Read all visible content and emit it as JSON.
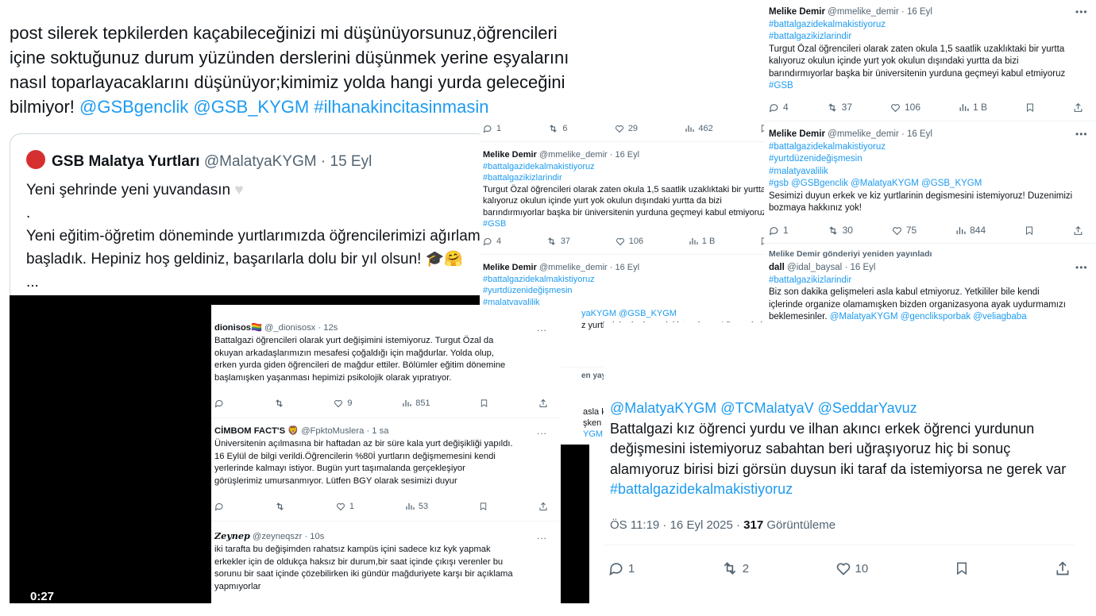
{
  "big_post": {
    "lines": [
      "post silerek tepkilerden kaçabileceğinizi mi düşünüyorsunuz,öğrencileri",
      "içine soktuğunuz durum yüzünden derslerini düşünmek yerine eşyalarını",
      "nasıl toparlayacaklarını düşünüyor;kimimiz yolda hangi yurda geleceğini"
    ],
    "last_line_text": "bilmiyor! ",
    "last_line_tags": "@GSBgenclik @GSB_KYGM #ilhanakincitasinmasin",
    "quote": {
      "name": "GSB Malatya Yurtları",
      "handle": "@MalatyaKYGM",
      "date": "· 15 Eyl",
      "line1": "Yeni şehrinde yeni yuvandasın",
      "line2": ".",
      "line3": "Yeni eğitim-öğretim döneminde yurtlarımızda öğrencilerimizi ağırlamaya",
      "line4": "başladık. Hepiniz hoş geldiniz, başarılarla dolu bir yıl olsun! 🎓🤗",
      "ellipsis": "..."
    },
    "video_time": "0:27"
  },
  "mid_panel": {
    "stats": {
      "replies": "1",
      "retweets": "6",
      "likes": "29",
      "views": "462"
    },
    "tweet1": {
      "name": "Melike Demir",
      "handle": "@mmelike_demir",
      "date": "· 16 Eyl",
      "tag1": "#battalgazidekalmakistiyoruz",
      "tag2": "#battalgazikizlarindir",
      "l1": "Turgut Özal öğrencileri olarak zaten okula 1,5 saatlik uzaklıktaki bir yurtta",
      "l2": "kalıyoruz okulun içinde yurt yok okulun dışındaki yurtta da bizi",
      "l3": "barındırmıyorlar başka bir üniversitenin yurduna geçmeyi kabul etmiyoruz",
      "tag3": "#GSB",
      "replies": "4",
      "retweets": "37",
      "likes": "106",
      "views": "1 B"
    },
    "tweet2": {
      "name": "Melike Demir",
      "handle": "@mmelike_demir",
      "date": "· 16 Eyl",
      "tag1": "#battalgazidekalmakistiyoruz",
      "tag2": "#yurtdüzenideğişmesin",
      "tag3": "#malatyavalilik",
      "l4": "yaKYGM @GSB_KYGM",
      "l5": "z yurtlarinin degismesini istemiyoruz! Duzenimizi",
      "likes": "75",
      "views": "844"
    },
    "repost_fragment": "en yayınladı",
    "frag1": "asla ka",
    "frag2": "şken b",
    "frag3": "YGM"
  },
  "right_panel": {
    "tweet1": {
      "name": "Melike Demir",
      "handle": "@mmelike_demir",
      "date": "· 16 Eyl",
      "tag1": "#battalgazidekalmakistiyoruz",
      "tag2": "#battalgazikizlarindir",
      "l1": "Turgut Özal öğrencileri olarak zaten okula 1,5 saatlik uzaklıktaki bir yurtta",
      "l2": "kalıyoruz okulun içinde yurt yok okulun dışındaki yurtta da bizi",
      "l3": "barındırmıyorlar başka bir üniversitenin yurduna geçmeyi kabul etmiyoruz",
      "tag3": "#GSB",
      "replies": "4",
      "retweets": "37",
      "likes": "106",
      "views": "1 B"
    },
    "tweet2": {
      "name": "Melike Demir",
      "handle": "@mmelike_demir",
      "date": "· 16 Eyl",
      "tag1": "#battalgazidekalmakistiyoruz",
      "tag2": "#yurtdüzenideğişmesin",
      "tag3": "#malatyavalilik",
      "tag4": "#gsb @GSBgenclik @MalatyaKYGM @GSB_KYGM",
      "l1": "Sesimizi duyun erkek ve kiz yurtlarinin degismesini istemiyoruz! Duzenimizi",
      "l2": "bozmaya hakkınız yok!",
      "replies": "1",
      "retweets": "30",
      "likes": "75",
      "views": "844"
    },
    "repost_label": "Melike Demir gönderiyi yeniden yayınladı",
    "tweet3": {
      "name": "dall",
      "handle": "@idal_baysal",
      "date": "· 16 Eyl",
      "tag1": "#battalgazikizlarindir",
      "l1": "Biz son dakika gelişmeleri asla kabul etmiyoruz. Yetkililer bile kendi",
      "l2": "içlerinde organize olamamışken bizden organizasyona ayak uydurmamızı",
      "l3": "beklemesinler. ",
      "tags": "@MalatyaKYGM @gencliksporbak @veliagbaba"
    }
  },
  "bottom_post": {
    "mentions": "@MalatyaKYGM @TCMalatyaV @SeddarYavuz",
    "l1": "Battalgazi kız öğrenci yurdu ve ilhan akıncı erkek öğrenci yurdunun",
    "l2": "değişmesini istemiyoruz sabahtan beri uğraşıyoruz hiç bi sonuç",
    "l3": "alamıyoruz birisi bizi görsün duysun iki taraf da istemiyorsa ne gerek var",
    "tag": "#battalgazidekalmakistiyoruz",
    "time": "ÖS 11:19 · 16 Eyl 2025 · ",
    "views_count": "317",
    "views_label": " Görüntüleme",
    "replies": "1",
    "retweets": "2",
    "likes": "10"
  },
  "replies_panel": {
    "r1": {
      "name": "dionisos🏳️‍🌈",
      "handle": "@_dionisosx",
      "date": "· 12s",
      "l1": "Battalgazi öğrencileri olarak yurt değişimini istemiyoruz. Turgut Özal da",
      "l2": "okuyan arkadaşlarımızın mesafesi çoğaldığı için mağdurlar. Yolda olup,",
      "l3": "erken yurda giden öğrencileri de mağdur ettiler. Bölümler eğitim dönemine",
      "l4": "başlamışken yaşanması hepimizi psikolojik olarak yıpratıyor.",
      "likes": "9",
      "views": "851"
    },
    "r2": {
      "name": "CİMBOM FACT'S 🦁",
      "handle": "@FpktoMuslera",
      "date": "· 1 sa",
      "l1": "Üniversitenin açılmasına bir haftadan az bir süre kala yurt değişikliği yapıldı.",
      "l2": "16 Eylül de bilgi verildi.Öğrencilerin %80İ yurtların değişmemesini kendi",
      "l3": "yerlerinde kalmayı istiyor. Bugün yurt taşımalanda gerçekleşiyor",
      "l4": "görüşlerimiz umursanmıyor. Lütfen BGY olarak sesimizi duyur",
      "likes": "1",
      "views": "53"
    },
    "r3": {
      "name": "Zeynep",
      "handle": "@zeyneqszr",
      "date": "· 10s",
      "l1": "iki tarafta bu değişimden rahatsız kampüs içini sadece kız kyk yapmak",
      "l2": "erkekler için de oldukça haksız bir durum,bir saat içinde çıkışı verenler bu",
      "l3": "sorunu bir saat içinde çözebilirken iki gündür mağduriyete karşı bir açıklama",
      "l4": "yapmıyorlar"
    },
    "more": "..."
  }
}
